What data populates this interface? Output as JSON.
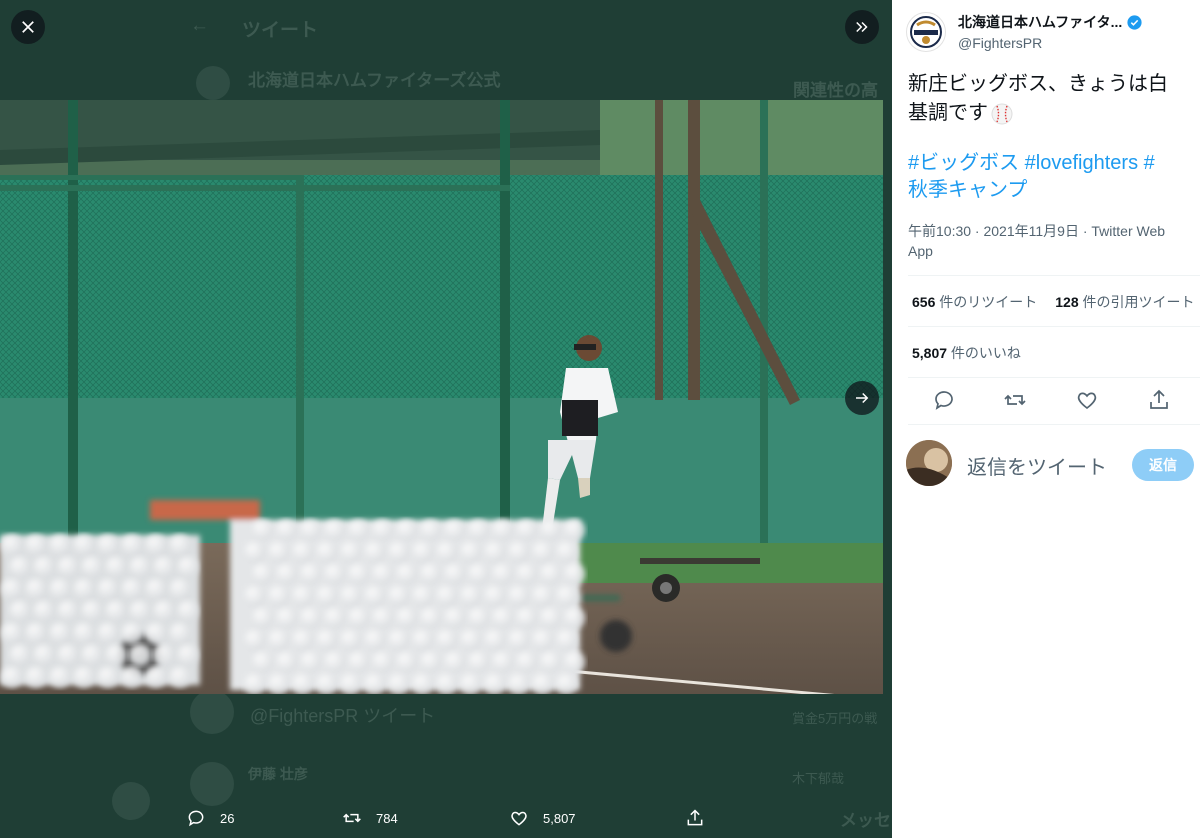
{
  "background_ui": {
    "header_title": "ツイート",
    "account_line": "北海道日本ハムファイターズ公式",
    "related_label": "関連性の高",
    "reply_prompt": "@FightersPR ツイート",
    "reply_user": "伊藤 壮彦",
    "side_text_1": "賞金5万円の戦",
    "side_text_2": "木下郁哉",
    "messages_label": "メッセ"
  },
  "viewer": {
    "close_icon": "close-icon",
    "collapse_icon": "double-chevron-right-icon",
    "next_icon": "arrow-right-icon"
  },
  "media_actions": {
    "reply_count": "26",
    "retweet_count": "784",
    "like_count": "5,807"
  },
  "tweet": {
    "display_name": "北海道日本ハムファイタ...",
    "handle": "@FightersPR",
    "text_line1": "新庄ビッグボス、きょうは白",
    "text_line2": "基調です",
    "hashtags_line1": "#ビッグボス #lovefighters #",
    "hashtags_line2": "秋季キャンプ",
    "timestamp": "午前10:30 · 2021年11月9日 · Twitter Web App",
    "retweets_num": "656",
    "retweets_label": " 件のリツイート",
    "quotes_num": "128",
    "quotes_label": " 件の引用ツイート",
    "likes_num": "5,807",
    "likes_label": " 件のいいね",
    "reply_placeholder": "返信をツイート",
    "reply_button": "返信"
  },
  "colors": {
    "accent": "#1d9bf0",
    "reply_button_disabled": "#8ecdf7",
    "verified": "#1d9bf0",
    "overlay": "#17332a"
  }
}
